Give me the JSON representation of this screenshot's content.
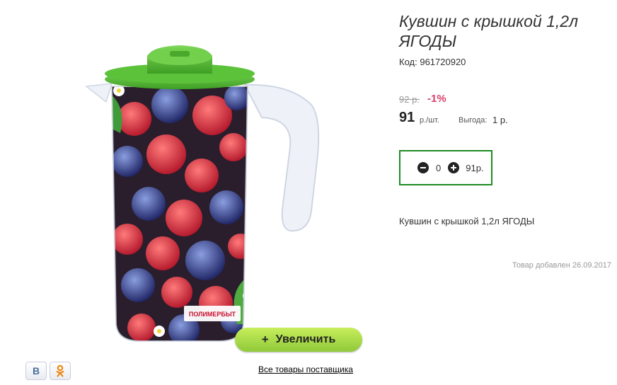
{
  "product": {
    "title": "Кувшин с крышкой 1,2л ЯГОДЫ",
    "code_label": "Код:",
    "code": "961720920",
    "old_price": "92 р.",
    "discount": "-1%",
    "price": "91",
    "price_unit": "р./шт.",
    "benefit_label": "Выгода:",
    "benefit_value": "1 р.",
    "description": "Кувшин с крышкой 1,2л ЯГОДЫ",
    "added": "Товар добавлен 26.09.2017",
    "image_brand_text": "ПОЛИМЕРБЫТ"
  },
  "quantity": {
    "value": "0",
    "total": "91р."
  },
  "zoom_button": {
    "icon": "+",
    "label": "Увеличить"
  },
  "social": {
    "vk": "B"
  },
  "supplier_link": "Все товары поставщика",
  "colors": {
    "lid": "#5cc23a",
    "qty_border": "#1f8a22",
    "discount": "#d9406b",
    "zoom_button": "#a8dc48"
  }
}
